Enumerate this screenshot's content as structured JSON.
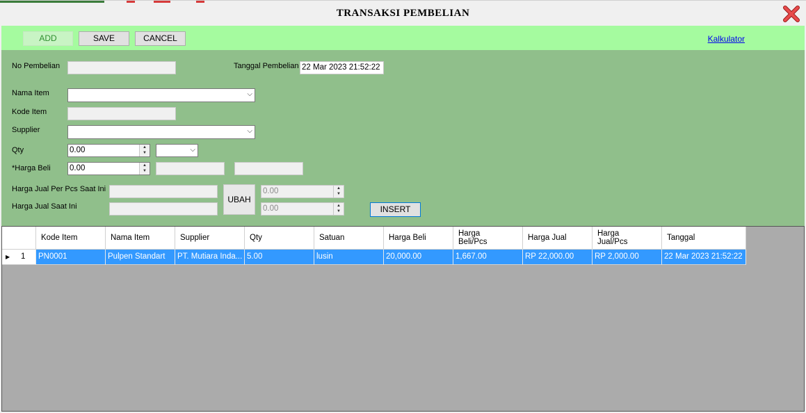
{
  "window": {
    "title": "TRANSAKSI PEMBELIAN"
  },
  "toolbar": {
    "add": "ADD",
    "save": "SAVE",
    "cancel": "CANCEL",
    "kalkulator": "Kalkulator"
  },
  "form": {
    "no_pembelian_label": "No Pembelian",
    "no_pembelian_value": "",
    "tanggal_label": "Tanggal Pembelian",
    "tanggal_value": "22 Mar 2023 21:52:22",
    "nama_item_label": "Nama Item",
    "nama_item_value": "",
    "kode_item_label": "Kode Item",
    "kode_item_value": "",
    "supplier_label": "Supplier",
    "supplier_value": "",
    "qty_label": "Qty",
    "qty_value": "0.00",
    "satuan_value": "",
    "harga_beli_label": "*Harga Beli",
    "harga_beli_value": "0.00",
    "harga_jual_pcs_label": "Harga Jual Per Pcs Saat Ini",
    "harga_jual_label": "Harga Jual Saat Ini",
    "ubah": "UBAH",
    "harga_jual_pcs_new": "0.00",
    "harga_jual_new": "0.00",
    "insert": "INSERT"
  },
  "grid": {
    "columns": [
      "Kode Item",
      "Nama Item",
      "Supplier",
      "Qty",
      "Satuan",
      "Harga Beli",
      "Harga Beli/Pcs",
      "Harga Jual",
      "Harga Jual/Pcs",
      "Tanggal"
    ],
    "rows": [
      {
        "row_number": "1",
        "cells": [
          "PN0001",
          "Pulpen Standart",
          "PT. Mutiara Inda...",
          "5.00",
          "lusin",
          "20,000.00",
          "1,667.00",
          "RP 22,000.00",
          "RP 2,000.00",
          "22 Mar 2023 21:52:22"
        ]
      }
    ]
  },
  "colors": {
    "toolbar_bg": "#a5fb9f",
    "form_bg": "#90bf8b",
    "grid_bg": "#ababab",
    "selection": "#3399ff",
    "close_icon": "#e03030"
  },
  "icons": {
    "close": "close-icon",
    "row_selector": "row-selector-arrow-icon",
    "dropdown": "chevron-down-icon",
    "spin": "spinner-arrows-icon"
  }
}
